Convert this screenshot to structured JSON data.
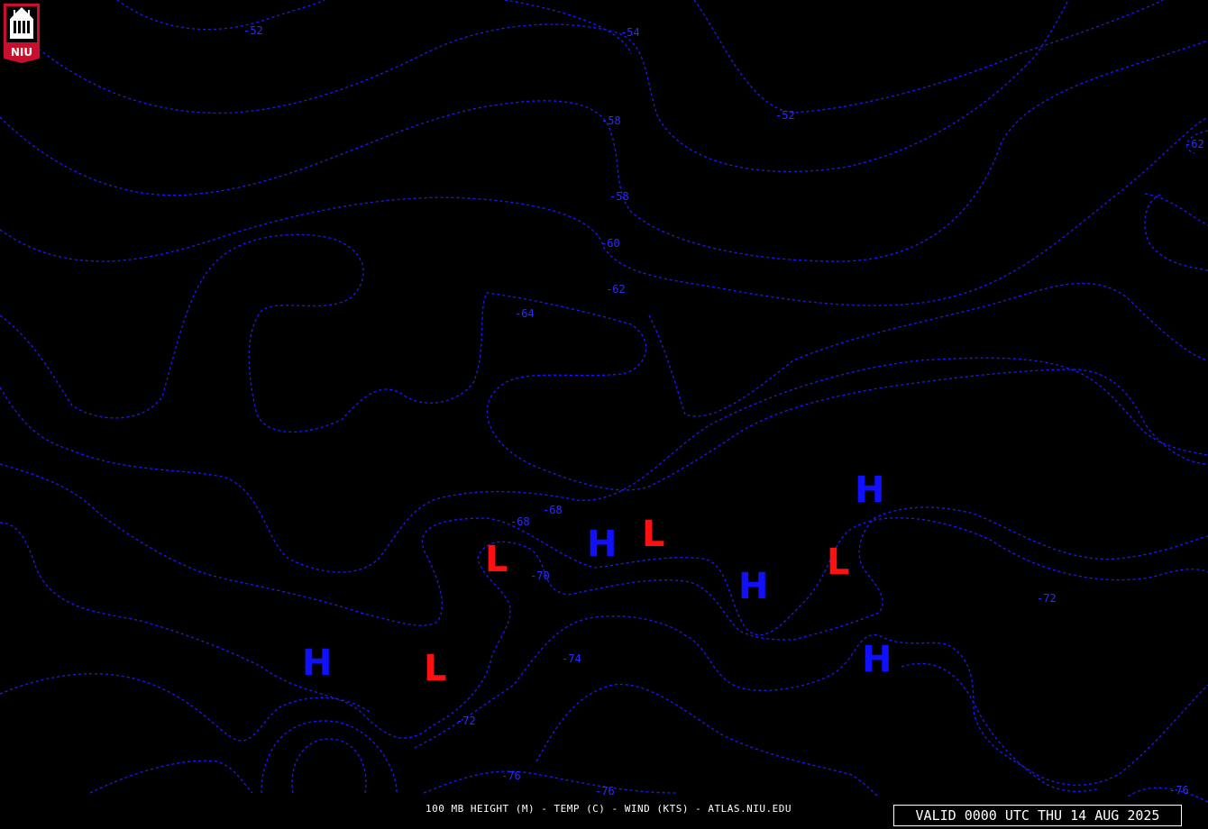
{
  "logo": {
    "text": "NIU",
    "colors": {
      "shield": "#c8102e",
      "building": "#ffffff",
      "base": "#000000"
    }
  },
  "map": {
    "colors": {
      "background": "#000000",
      "isotherm": "#1a1aff",
      "high_center": "#1010ff",
      "low_center": "#ff1010"
    },
    "contour_labels": [
      {
        "id": "n52a",
        "text": "-52"
      },
      {
        "id": "n54",
        "text": "-54"
      },
      {
        "id": "n52b",
        "text": "-52"
      },
      {
        "id": "n62r",
        "text": "-62"
      },
      {
        "id": "n58a",
        "text": "-58"
      },
      {
        "id": "n58b",
        "text": "-58"
      },
      {
        "id": "n60",
        "text": "-60"
      },
      {
        "id": "n62",
        "text": "-62"
      },
      {
        "id": "n64",
        "text": "-64"
      },
      {
        "id": "n68a",
        "text": "-68"
      },
      {
        "id": "n68b",
        "text": "-68"
      },
      {
        "id": "n70",
        "text": "-70"
      },
      {
        "id": "n72a",
        "text": "-72"
      },
      {
        "id": "n74",
        "text": "-74"
      },
      {
        "id": "n72b",
        "text": "-72"
      },
      {
        "id": "n76a",
        "text": "-76"
      },
      {
        "id": "n76b",
        "text": "-76"
      },
      {
        "id": "n76c",
        "text": "-76"
      }
    ],
    "centers": [
      {
        "id": "h1",
        "type": "H"
      },
      {
        "id": "h2",
        "type": "H"
      },
      {
        "id": "h3",
        "type": "H"
      },
      {
        "id": "h4",
        "type": "H"
      },
      {
        "id": "h5",
        "type": "H"
      },
      {
        "id": "l1",
        "type": "L"
      },
      {
        "id": "l2",
        "type": "L"
      },
      {
        "id": "l3",
        "type": "L"
      },
      {
        "id": "l4",
        "type": "L"
      }
    ]
  },
  "footer": {
    "caption": "100 MB HEIGHT (M) - TEMP (C) - WIND (KTS) - ATLAS.NIU.EDU",
    "valid": "VALID 0000 UTC THU 14 AUG 2025"
  }
}
